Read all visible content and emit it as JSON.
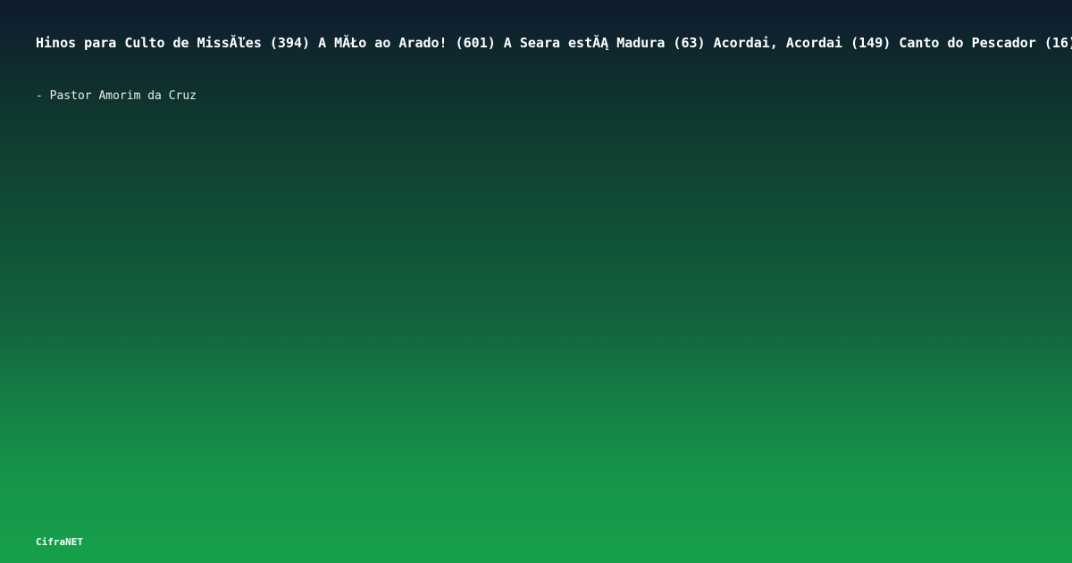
{
  "card": {
    "title": "Hinos para Culto de MissĂľes (394) A MĂŁo ao Arado! (601) A Seara estĂĄ Madura (63) Acordai, Acordai (149) Canto do Pescador (16)",
    "author": "- Pastor Amorim da Cruz",
    "brand": "CifraNET"
  },
  "colors": {
    "gradient_top": "#0f1a2d",
    "gradient_bottom": "#16a04a",
    "text": "#ffffff"
  }
}
